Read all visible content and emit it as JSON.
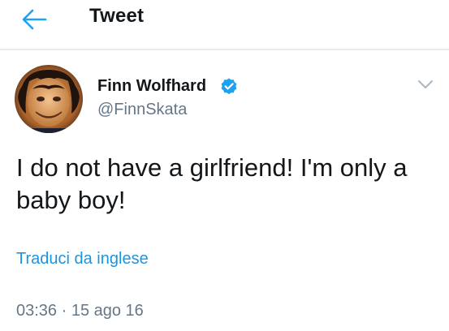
{
  "header": {
    "title": "Tweet",
    "back_icon": "arrow-left-icon",
    "accent_color": "#1da1f2"
  },
  "tweet": {
    "author": {
      "name": "Finn Wolfhard",
      "handle": "@FinnSkata",
      "verified": true,
      "verified_icon": "verified-badge-icon"
    },
    "menu_icon": "chevron-down-icon",
    "text": "I do not have a girlfriend! I'm only a baby boy!",
    "translate_label": "Traduci da inglese",
    "timestamp": "03:36 · 15 ago 16"
  }
}
